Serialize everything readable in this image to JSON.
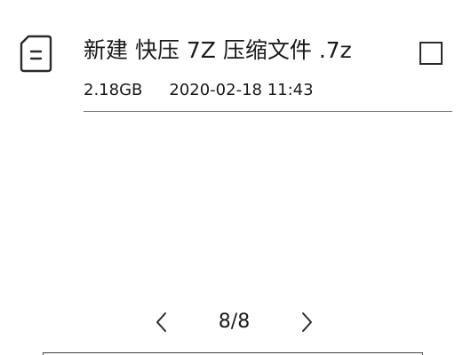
{
  "file": {
    "name": "新建 快压 7Z 压缩文件 .7z",
    "size": "2.18GB",
    "modified": "2020-02-18 11:43",
    "icon": "document-icon",
    "selected": false
  },
  "pager": {
    "label": "8/8",
    "prev_icon": "chevron-left-icon",
    "next_icon": "chevron-right-icon"
  }
}
